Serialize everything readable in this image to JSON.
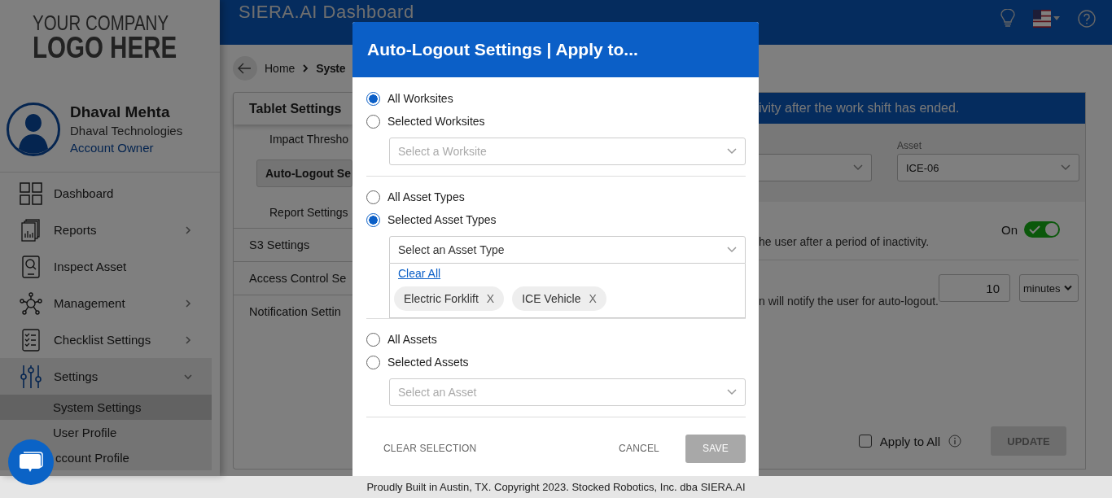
{
  "sidebar": {
    "logo_lines": [
      "YOUR COMPANY",
      "LOGO HERE"
    ],
    "user": {
      "name": "Dhaval Mehta",
      "company": "Dhaval Technologies",
      "role": "Account Owner"
    },
    "items": [
      {
        "label": "Dashboard",
        "expandable": false,
        "expanded": false
      },
      {
        "label": "Reports",
        "expandable": true,
        "expanded": false
      },
      {
        "label": "Inspect Asset",
        "expandable": false,
        "expanded": false
      },
      {
        "label": "Management",
        "expandable": true,
        "expanded": false
      },
      {
        "label": "Checklist Settings",
        "expandable": true,
        "expanded": false
      },
      {
        "label": "Settings",
        "expandable": true,
        "expanded": true,
        "children": [
          {
            "label": "System Settings",
            "selected": true
          },
          {
            "label": "User Profile",
            "selected": false
          },
          {
            "label": "ccount Profile",
            "selected": false
          }
        ]
      }
    ]
  },
  "header": {
    "title": "SIERA.AI Dashboard"
  },
  "breadcrumb": [
    "Home",
    "Syste"
  ],
  "settings_menu": [
    {
      "label": "Tablet Settings",
      "expanded": true,
      "children": [
        {
          "label": "Impact Thresho",
          "selected": false
        },
        {
          "label": "Auto-Logout Se",
          "selected": true
        },
        {
          "label": "Report Settings",
          "selected": false
        }
      ]
    },
    {
      "label": "S3 Settings",
      "expanded": false
    },
    {
      "label": "Access Control Se",
      "expanded": false
    },
    {
      "label": "Notification Settin",
      "expanded": false
    }
  ],
  "panel": {
    "banner": "ivity after the work shift has ended.",
    "asset_filter": {
      "label": "Asset",
      "value": "ICE-06"
    },
    "auto_logout": {
      "status": "On",
      "on": true,
      "description": "he user after a period of inactivity."
    },
    "warning": {
      "value": "10",
      "unit": "minutes",
      "description": "n will notify the user for auto-logout."
    },
    "apply_to_all": {
      "label": "Apply to All",
      "checked": false
    },
    "update_button": {
      "label": "UPDATE",
      "disabled": true
    }
  },
  "modal": {
    "title": "Auto-Logout Settings | Apply to...",
    "sections": [
      {
        "options": [
          {
            "label": "All Worksites",
            "selected": true
          },
          {
            "label": "Selected Worksites",
            "selected": false
          }
        ],
        "select": {
          "placeholder": "Select a Worksite",
          "expanded": false
        }
      },
      {
        "options": [
          {
            "label": "All Asset Types",
            "selected": false
          },
          {
            "label": "Selected Asset Types",
            "selected": true
          }
        ],
        "select": {
          "value": "Select an Asset Type",
          "expanded": true,
          "clear_label": "Clear All",
          "chips": [
            {
              "label": "Electric Forklift",
              "remove": "X"
            },
            {
              "label": "ICE Vehicle",
              "remove": "X"
            }
          ]
        }
      },
      {
        "options": [
          {
            "label": "All Assets",
            "selected": false
          },
          {
            "label": "Selected Assets",
            "selected": false
          }
        ],
        "select": {
          "placeholder": "Select an Asset",
          "expanded": false
        }
      }
    ],
    "buttons": [
      {
        "label": "CLEAR SELECTION",
        "kind": "text",
        "disabled": false
      },
      {
        "label": "CANCEL",
        "kind": "text",
        "disabled": false
      },
      {
        "label": "SAVE",
        "kind": "primary",
        "disabled": true
      }
    ]
  },
  "footer": "Proudly Built in Austin, TX. Copyright 2023. Stocked Robotics, Inc. dba SIERA.AI"
}
